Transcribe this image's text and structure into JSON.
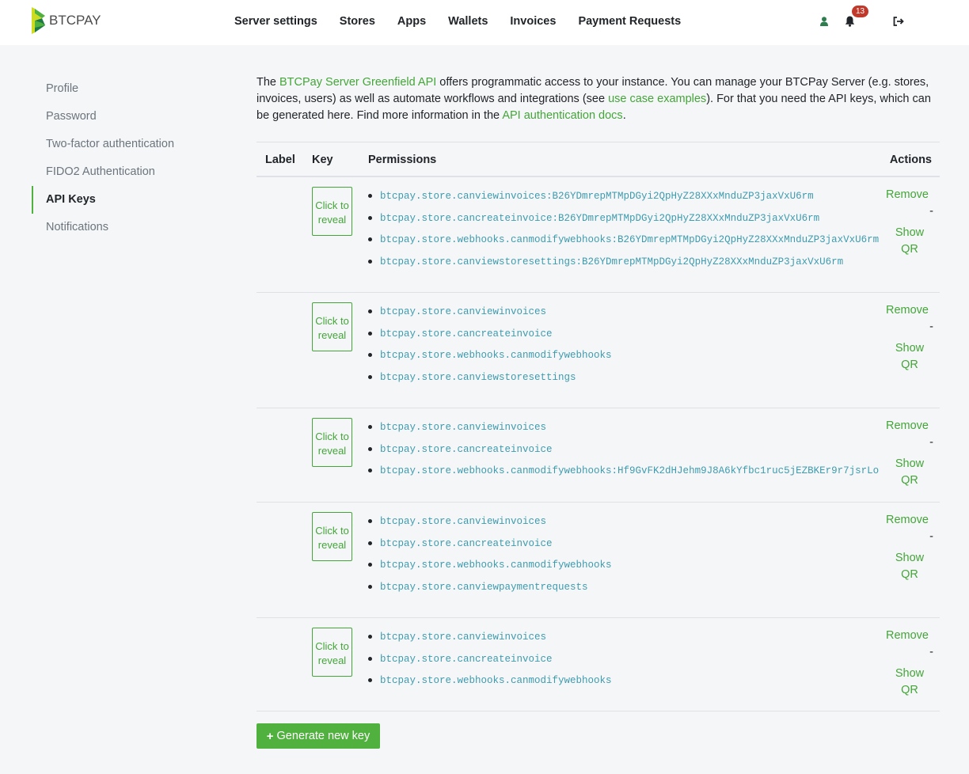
{
  "brand": {
    "name": "BTCPAY"
  },
  "nav": {
    "links": [
      "Server settings",
      "Stores",
      "Apps",
      "Wallets",
      "Invoices",
      "Payment Requests"
    ],
    "notifications_count": "13"
  },
  "sidebar": {
    "items": [
      "Profile",
      "Password",
      "Two-factor authentication",
      "FIDO2 Authentication",
      "API Keys",
      "Notifications"
    ],
    "active": "API Keys"
  },
  "intro": {
    "t1": "The ",
    "link1": "BTCPay Server Greenfield API",
    "t2": " offers programmatic access to your instance. You can manage your BTCPay Server (e.g. stores, invoices, users) as well as automate workflows and integrations (see ",
    "link2": "use case examples",
    "t3": "). For that you need the API keys, which can be generated here. Find more information in the ",
    "link3": "API authentication docs",
    "t4": "."
  },
  "table": {
    "headers": {
      "label": "Label",
      "key": "Key",
      "permissions": "Permissions",
      "actions": "Actions"
    },
    "reveal_label": "Click to reveal",
    "remove_label": "Remove",
    "separator": "-",
    "qr_label": "Show QR",
    "rows": [
      {
        "permissions": [
          "btcpay.store.canviewinvoices:B26YDmrepMTMpDGyi2QpHyZ28XXxMnduZP3jaxVxU6rm",
          "btcpay.store.cancreateinvoice:B26YDmrepMTMpDGyi2QpHyZ28XXxMnduZP3jaxVxU6rm",
          "btcpay.store.webhooks.canmodifywebhooks:B26YDmrepMTMpDGyi2QpHyZ28XXxMnduZP3jaxVxU6rm",
          "btcpay.store.canviewstoresettings:B26YDmrepMTMpDGyi2QpHyZ28XXxMnduZP3jaxVxU6rm"
        ]
      },
      {
        "permissions": [
          "btcpay.store.canviewinvoices",
          "btcpay.store.cancreateinvoice",
          "btcpay.store.webhooks.canmodifywebhooks",
          "btcpay.store.canviewstoresettings"
        ]
      },
      {
        "permissions": [
          "btcpay.store.canviewinvoices",
          "btcpay.store.cancreateinvoice",
          "btcpay.store.webhooks.canmodifywebhooks:Hf9GvFK2dHJehm9J8A6kYfbc1ruc5jEZBKEr9r7jsrLo"
        ]
      },
      {
        "permissions": [
          "btcpay.store.canviewinvoices",
          "btcpay.store.cancreateinvoice",
          "btcpay.store.webhooks.canmodifywebhooks",
          "btcpay.store.canviewpaymentrequests"
        ]
      },
      {
        "permissions": [
          "btcpay.store.canviewinvoices",
          "btcpay.store.cancreateinvoice",
          "btcpay.store.webhooks.canmodifywebhooks"
        ]
      }
    ]
  },
  "generate_label": "Generate new key",
  "colors": {
    "accent": "#51b13e",
    "link": "#44a539",
    "code": "#3e9bae",
    "badge": "#c0392b"
  }
}
